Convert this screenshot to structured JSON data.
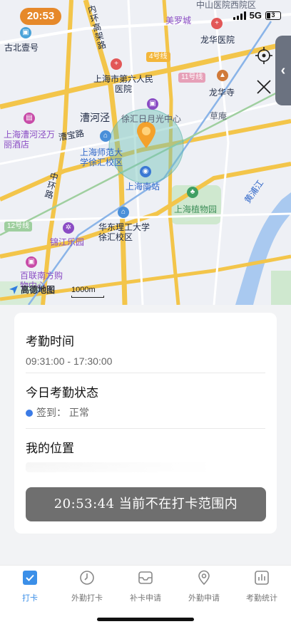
{
  "status_bar": {
    "time": "20:53",
    "network": "5G",
    "battery": "3"
  },
  "map": {
    "labels": {
      "zhongshan_hospital": "中山医院西院区",
      "meiluocheng": "美罗城",
      "neihuan": "内环高架路",
      "gubei": "古北壹号",
      "longhua_hospital": "龙华医院",
      "line4": "4号线",
      "sixth_hospital": "上海市第六人民医院",
      "line11": "11号线",
      "longhua_temple": "龙华寺",
      "caohejing": "漕河泾",
      "xujiahui_sunshine": "徐汇日月光中心",
      "caoan": "草庵",
      "hotel": "上海漕河泾万丽酒店",
      "caobao": "漕宝路",
      "shnu": "上海师范大学徐汇校区",
      "south_station": "上海南站",
      "zhonghuan": "中环路",
      "botanical": "上海植物园",
      "huangpu": "黄浦江",
      "line12": "12号线",
      "ecust": "华东理工大学徐汇校区",
      "jinjiang": "锦江乐园",
      "bailian": "百联南方购物中心",
      "logo": "高德地图",
      "scale": "1000m"
    }
  },
  "attendance": {
    "time_title": "考勤时间",
    "time_value": "09:31:00 - 17:30:00",
    "status_title": "今日考勤状态",
    "status_value": "签到： 正常",
    "location_title": "我的位置",
    "toast": "20:53:44  当前不在打卡范围内"
  },
  "tabs": [
    {
      "label": "打卡",
      "icon": "check-square-icon",
      "active": true
    },
    {
      "label": "外勤打卡",
      "icon": "clock-icon",
      "active": false
    },
    {
      "label": "补卡申请",
      "icon": "inbox-icon",
      "active": false
    },
    {
      "label": "外勤申请",
      "icon": "location-pin-icon",
      "active": false
    },
    {
      "label": "考勤统计",
      "icon": "bar-chart-icon",
      "active": false
    }
  ],
  "colors": {
    "accent": "#3b8fe8",
    "time_pill": "#e6892a",
    "toast_bg": "#6f6f6f",
    "status_dot": "#3b7be6"
  }
}
